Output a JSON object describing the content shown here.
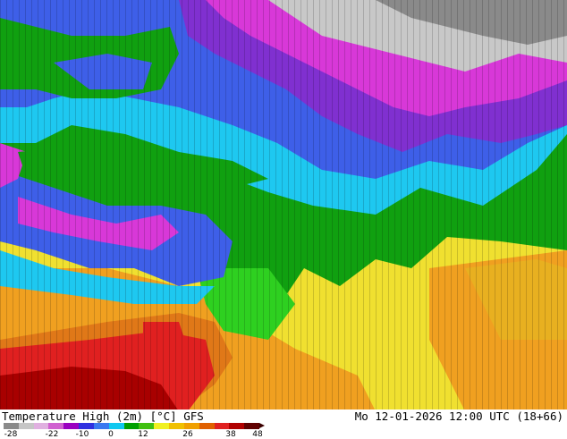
{
  "map": {
    "title": "Temperature High (2m) [°C] GFS",
    "valid_time": "Mo 12-01-2026 12:00 UTC (18+66)",
    "legend": {
      "tick_labels": [
        "-28",
        "-22",
        "-10",
        "0",
        "12",
        "26",
        "38",
        "48"
      ],
      "colors": [
        "#8a8a8a",
        "#c6c6c6",
        "#e0b0e0",
        "#d060d0",
        "#9a00c0",
        "#3030e0",
        "#3a78f0",
        "#10c8f0",
        "#00a000",
        "#40c010",
        "#f0f020",
        "#f0c000",
        "#f0a000",
        "#e06000",
        "#e02020",
        "#b00000",
        "#600000"
      ]
    },
    "region_colors": {
      "cold_north": "#9a9a9a",
      "snow": "#d0d0d0",
      "magenta": "#d838d8",
      "purple": "#8030d0",
      "blue": "#3e5fe8",
      "cyan": "#1ec8f0",
      "green": "#10a010",
      "bright_green": "#2ed020",
      "yellow": "#f0e030",
      "orange": "#f0a020",
      "dark_orange": "#e07818",
      "red": "#e02020",
      "dark_red": "#a80000"
    }
  }
}
